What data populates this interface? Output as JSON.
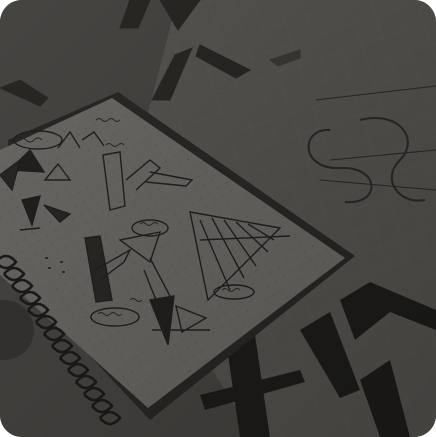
{
  "image": {
    "subject": "logo-sketches-on-notebook-and-grid-paper",
    "tone": "dark-overlay",
    "colors": {
      "background": "#4d4b48",
      "notebook_page": "#6c6a66",
      "grid_paper": "#5a5855",
      "sketch_ink": "#232220",
      "spiral_wire": "#1e1e1d"
    }
  }
}
